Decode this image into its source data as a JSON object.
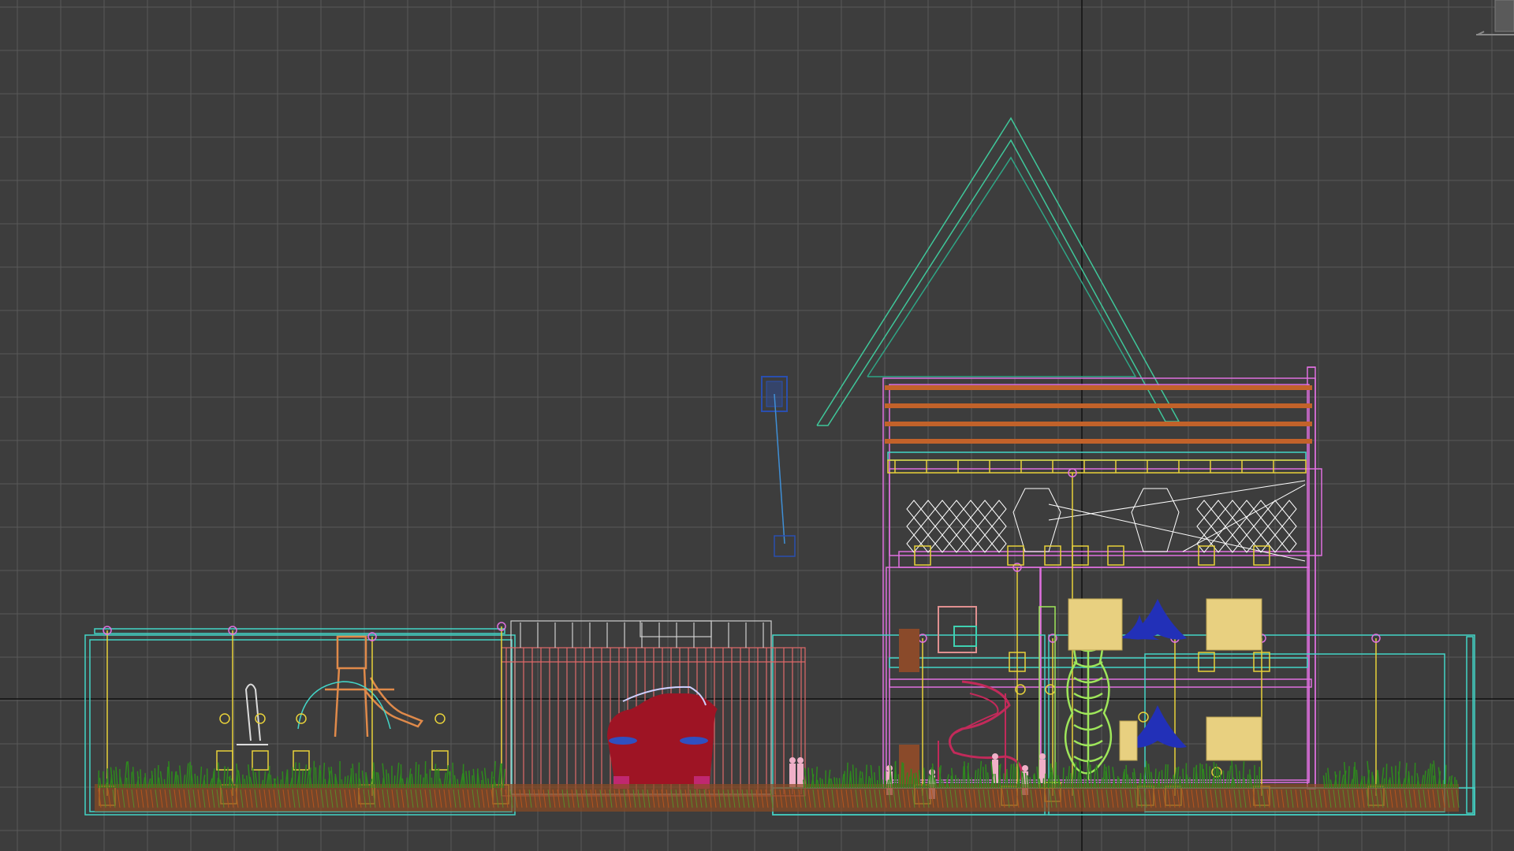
{
  "viewport": {
    "view": "front",
    "background_color": "#3d3d3d",
    "grid_color": "#595959",
    "axis_color": "#111111",
    "grid_visible": true
  },
  "colors": {
    "roof": "#3fc79a",
    "roof_inner": "#2fa585",
    "house_outline": "#e070e0",
    "house_beam": "#c2622a",
    "fence": "#43d5c7",
    "gate": "#e06a6a",
    "gate_frame": "#cfcfcf",
    "car": "#9e1424",
    "light_pole": "#e8d23a",
    "grass": "#2e8a1e",
    "soil": "#8a4a22",
    "playground": "#e08a4a",
    "camera": "#2a4fb0",
    "camera_target_line": "#3f8fd6",
    "plant_green": "#9ee65a",
    "ornament_blue": "#2230b8",
    "stair": "#c22a5a",
    "figure": "#f0b0c8"
  },
  "icons": {
    "camera": "camera-icon",
    "camera_target": "camera-target-icon",
    "viewcube": "viewcube-icon"
  }
}
